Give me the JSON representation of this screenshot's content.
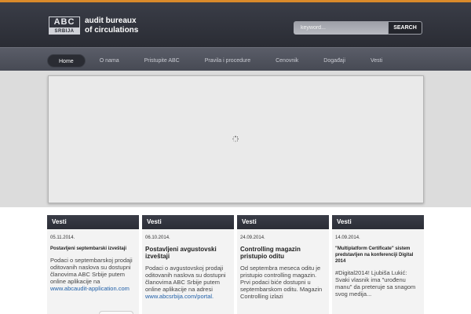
{
  "header": {
    "logo_abc": "ABC",
    "logo_srbija": "SRBIJA",
    "title_line1": "audit bureaux",
    "title_line2": "of circulations"
  },
  "search": {
    "placeholder": "keyword...",
    "button_label": "SEARCH"
  },
  "nav": {
    "items": [
      {
        "label": "Home",
        "active": true
      },
      {
        "label": "O nama"
      },
      {
        "label": "Pristupite ABC"
      },
      {
        "label": "Pravila i procedure"
      },
      {
        "label": "Cenovnik"
      },
      {
        "label": "Događaji"
      },
      {
        "label": "Vesti"
      }
    ]
  },
  "news": [
    {
      "heading": "Vesti",
      "date": "05.11.2014.",
      "title": "Postavljeni septembarski izveštaji",
      "text": "Podaci o septembarskoj prodaji oditovanih naslova su dostupni članovima ABC Srbije putem online aplikacije na",
      "link": "www.abcaudit-application.com"
    },
    {
      "heading": "Vesti",
      "date": "06.10.2014.",
      "title": "Postavljeni avgustovski izveštaji",
      "text": "Podaci o avgustovskoj prodaji oditovanih naslova su dostupni članovima ABC Srbije putem online aplikacije na adresi",
      "link": "www.abcsrbija.com/portal."
    },
    {
      "heading": "Vesti",
      "date": "24.09.2014.",
      "title": "Controlling magazin pristupio oditu",
      "text": "Od septembra meseca oditu je pristupio controlling magazin. Prvi podaci biće dostupni u septembarskom oditu. Magazin Controlling izlazi"
    },
    {
      "heading": "Vesti",
      "date": "14.09.2014.",
      "title": "\"Multiplatform Certificate\" sistem predstavljen na konferenciji Digital 2014",
      "text": "#Digital2014! Ljubiša Lukić: Svaki vlasnik ima \"urođenu manu\" da preteruje sa snagom svog medija..."
    }
  ],
  "colors": {
    "accent": "#d98a2b",
    "header_bg": "#2a2c34",
    "nav_bg": "#4f525c",
    "link": "#1f5fa8"
  },
  "icons": {
    "loading": "spinner-icon"
  }
}
